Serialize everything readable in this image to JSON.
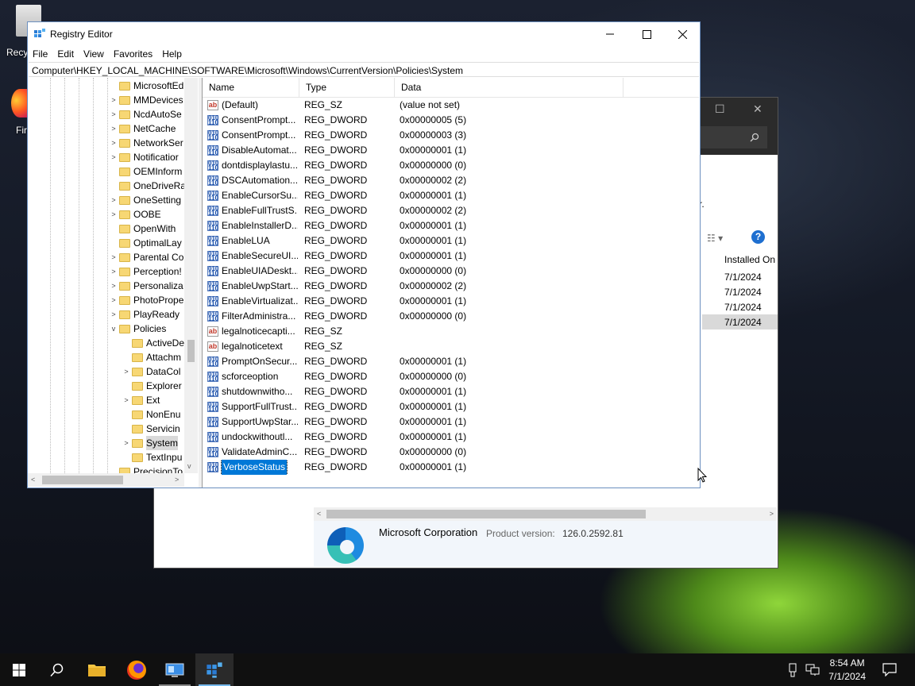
{
  "desktop": {
    "icons": [
      {
        "label": "Recy"
      },
      {
        "label": "Fir"
      }
    ]
  },
  "background_window": {
    "partial_text": "r.",
    "column_installed_on": "Installed On",
    "dates": [
      "7/1/2024",
      "7/1/2024",
      "7/1/2024",
      "7/1/2024"
    ],
    "publisher": "Microsoft Corporation",
    "product_version_label": "Product version:",
    "product_version": "126.0.2592.81"
  },
  "regedit": {
    "title": "Registry Editor",
    "menu": [
      "File",
      "Edit",
      "View",
      "Favorites",
      "Help"
    ],
    "address": "Computer\\HKEY_LOCAL_MACHINE\\SOFTWARE\\Microsoft\\Windows\\CurrentVersion\\Policies\\System",
    "tree": [
      {
        "label": "MicrosoftEd",
        "depth": 0,
        "expander": ""
      },
      {
        "label": "MMDevices",
        "depth": 0,
        "expander": ">"
      },
      {
        "label": "NcdAutoSe",
        "depth": 0,
        "expander": ">"
      },
      {
        "label": "NetCache",
        "depth": 0,
        "expander": ">"
      },
      {
        "label": "NetworkSer",
        "depth": 0,
        "expander": ">"
      },
      {
        "label": "Notificatior",
        "depth": 0,
        "expander": ">"
      },
      {
        "label": "OEMInform",
        "depth": 0,
        "expander": ""
      },
      {
        "label": "OneDriveRa",
        "depth": 0,
        "expander": ""
      },
      {
        "label": "OneSetting",
        "depth": 0,
        "expander": ">"
      },
      {
        "label": "OOBE",
        "depth": 0,
        "expander": ">"
      },
      {
        "label": "OpenWith",
        "depth": 0,
        "expander": ""
      },
      {
        "label": "OptimalLay",
        "depth": 0,
        "expander": ""
      },
      {
        "label": "Parental Co",
        "depth": 0,
        "expander": ">"
      },
      {
        "label": "Perception!",
        "depth": 0,
        "expander": ">"
      },
      {
        "label": "Personaliza",
        "depth": 0,
        "expander": ">"
      },
      {
        "label": "PhotoPrope",
        "depth": 0,
        "expander": ">"
      },
      {
        "label": "PlayReady",
        "depth": 0,
        "expander": ">"
      },
      {
        "label": "Policies",
        "depth": 0,
        "expander": "v"
      },
      {
        "label": "ActiveDe",
        "depth": 1,
        "expander": ""
      },
      {
        "label": "Attachm",
        "depth": 1,
        "expander": ""
      },
      {
        "label": "DataCol",
        "depth": 1,
        "expander": ">"
      },
      {
        "label": "Explorer",
        "depth": 1,
        "expander": ""
      },
      {
        "label": "Ext",
        "depth": 1,
        "expander": ">"
      },
      {
        "label": "NonEnu",
        "depth": 1,
        "expander": ""
      },
      {
        "label": "Servicin",
        "depth": 1,
        "expander": ""
      },
      {
        "label": "System",
        "depth": 1,
        "expander": ">",
        "selected": true
      },
      {
        "label": "TextInpu",
        "depth": 1,
        "expander": ""
      },
      {
        "label": "PrecisionTo",
        "depth": 0,
        "expander": ""
      }
    ],
    "columns": {
      "name": "Name",
      "type": "Type",
      "data": "Data"
    },
    "values": [
      {
        "name": "(Default)",
        "type": "REG_SZ",
        "data": "(value not set)",
        "kind": "sz"
      },
      {
        "name": "ConsentPrompt...",
        "type": "REG_DWORD",
        "data": "0x00000005 (5)",
        "kind": "dw"
      },
      {
        "name": "ConsentPrompt...",
        "type": "REG_DWORD",
        "data": "0x00000003 (3)",
        "kind": "dw"
      },
      {
        "name": "DisableAutomat...",
        "type": "REG_DWORD",
        "data": "0x00000001 (1)",
        "kind": "dw"
      },
      {
        "name": "dontdisplaylastu...",
        "type": "REG_DWORD",
        "data": "0x00000000 (0)",
        "kind": "dw"
      },
      {
        "name": "DSCAutomation...",
        "type": "REG_DWORD",
        "data": "0x00000002 (2)",
        "kind": "dw"
      },
      {
        "name": "EnableCursorSu...",
        "type": "REG_DWORD",
        "data": "0x00000001 (1)",
        "kind": "dw"
      },
      {
        "name": "EnableFullTrustS...",
        "type": "REG_DWORD",
        "data": "0x00000002 (2)",
        "kind": "dw"
      },
      {
        "name": "EnableInstallerD...",
        "type": "REG_DWORD",
        "data": "0x00000001 (1)",
        "kind": "dw"
      },
      {
        "name": "EnableLUA",
        "type": "REG_DWORD",
        "data": "0x00000001 (1)",
        "kind": "dw"
      },
      {
        "name": "EnableSecureUI...",
        "type": "REG_DWORD",
        "data": "0x00000001 (1)",
        "kind": "dw"
      },
      {
        "name": "EnableUIADeskt...",
        "type": "REG_DWORD",
        "data": "0x00000000 (0)",
        "kind": "dw"
      },
      {
        "name": "EnableUwpStart...",
        "type": "REG_DWORD",
        "data": "0x00000002 (2)",
        "kind": "dw"
      },
      {
        "name": "EnableVirtualizat...",
        "type": "REG_DWORD",
        "data": "0x00000001 (1)",
        "kind": "dw"
      },
      {
        "name": "FilterAdministra...",
        "type": "REG_DWORD",
        "data": "0x00000000 (0)",
        "kind": "dw"
      },
      {
        "name": "legalnoticecapti...",
        "type": "REG_SZ",
        "data": "",
        "kind": "sz"
      },
      {
        "name": "legalnoticetext",
        "type": "REG_SZ",
        "data": "",
        "kind": "sz"
      },
      {
        "name": "PromptOnSecur...",
        "type": "REG_DWORD",
        "data": "0x00000001 (1)",
        "kind": "dw"
      },
      {
        "name": "scforceoption",
        "type": "REG_DWORD",
        "data": "0x00000000 (0)",
        "kind": "dw"
      },
      {
        "name": "shutdownwitho...",
        "type": "REG_DWORD",
        "data": "0x00000001 (1)",
        "kind": "dw"
      },
      {
        "name": "SupportFullTrust...",
        "type": "REG_DWORD",
        "data": "0x00000001 (1)",
        "kind": "dw"
      },
      {
        "name": "SupportUwpStar...",
        "type": "REG_DWORD",
        "data": "0x00000001 (1)",
        "kind": "dw"
      },
      {
        "name": "undockwithoutl...",
        "type": "REG_DWORD",
        "data": "0x00000001 (1)",
        "kind": "dw"
      },
      {
        "name": "ValidateAdminC...",
        "type": "REG_DWORD",
        "data": "0x00000000 (0)",
        "kind": "dw"
      },
      {
        "name": "VerboseStatus",
        "type": "REG_DWORD",
        "data": "0x00000001 (1)",
        "kind": "dw",
        "selected": true
      }
    ]
  },
  "taskbar": {
    "items": [
      {
        "name": "start-button",
        "icon": "windows-logo-icon"
      },
      {
        "name": "search-button",
        "icon": "search-icon"
      },
      {
        "name": "file-explorer-button",
        "icon": "folder-icon"
      },
      {
        "name": "firefox-button",
        "icon": "firefox-icon"
      },
      {
        "name": "control-panel-button",
        "icon": "control-panel-icon"
      },
      {
        "name": "registry-editor-button",
        "icon": "registry-editor-icon"
      }
    ],
    "time": "8:54 AM",
    "date": "7/1/2024"
  },
  "colors": {
    "selection": "#0078d7",
    "taskbar": "#101010",
    "accent": "#76b9ed"
  }
}
